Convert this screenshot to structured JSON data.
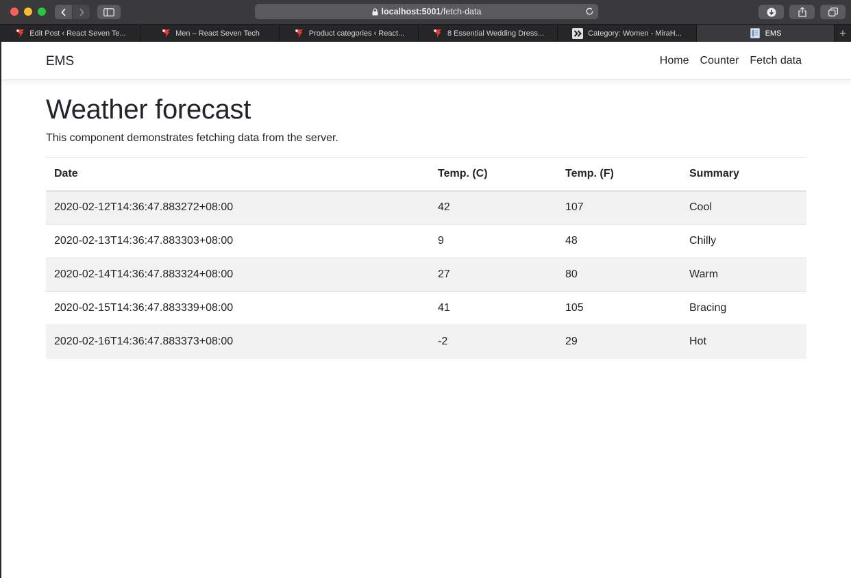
{
  "browser": {
    "url_host": "localhost:5001",
    "url_path": "/fetch-data",
    "tabs": [
      {
        "label": "Edit Post ‹ React Seven Te...",
        "icon": "react-seven-tech-icon"
      },
      {
        "label": "Men – React Seven Tech",
        "icon": "react-seven-tech-icon"
      },
      {
        "label": "Product categories ‹ React...",
        "icon": "react-seven-tech-icon"
      },
      {
        "label": "8 Essential Wedding Dress...",
        "icon": "react-seven-tech-icon"
      },
      {
        "label": "Category: Women - MiraH...",
        "icon": "double-chevron-icon"
      },
      {
        "label": "EMS",
        "icon": "document-icon"
      }
    ]
  },
  "navbar": {
    "brand": "EMS",
    "links": [
      "Home",
      "Counter",
      "Fetch data"
    ]
  },
  "main": {
    "title": "Weather forecast",
    "description": "This component demonstrates fetching data from the server.",
    "table": {
      "headers": [
        "Date",
        "Temp. (C)",
        "Temp. (F)",
        "Summary"
      ],
      "rows": [
        [
          "2020-02-12T14:36:47.883272+08:00",
          "42",
          "107",
          "Cool"
        ],
        [
          "2020-02-13T14:36:47.883303+08:00",
          "9",
          "48",
          "Chilly"
        ],
        [
          "2020-02-14T14:36:47.883324+08:00",
          "27",
          "80",
          "Warm"
        ],
        [
          "2020-02-15T14:36:47.883339+08:00",
          "41",
          "105",
          "Bracing"
        ],
        [
          "2020-02-16T14:36:47.883373+08:00",
          "-2",
          "29",
          "Hot"
        ]
      ]
    }
  },
  "colors": {
    "chrome": "#3a3a3c",
    "text": "#212529",
    "stripe": "#f2f2f2",
    "favicon_red": "#e63a2e"
  }
}
